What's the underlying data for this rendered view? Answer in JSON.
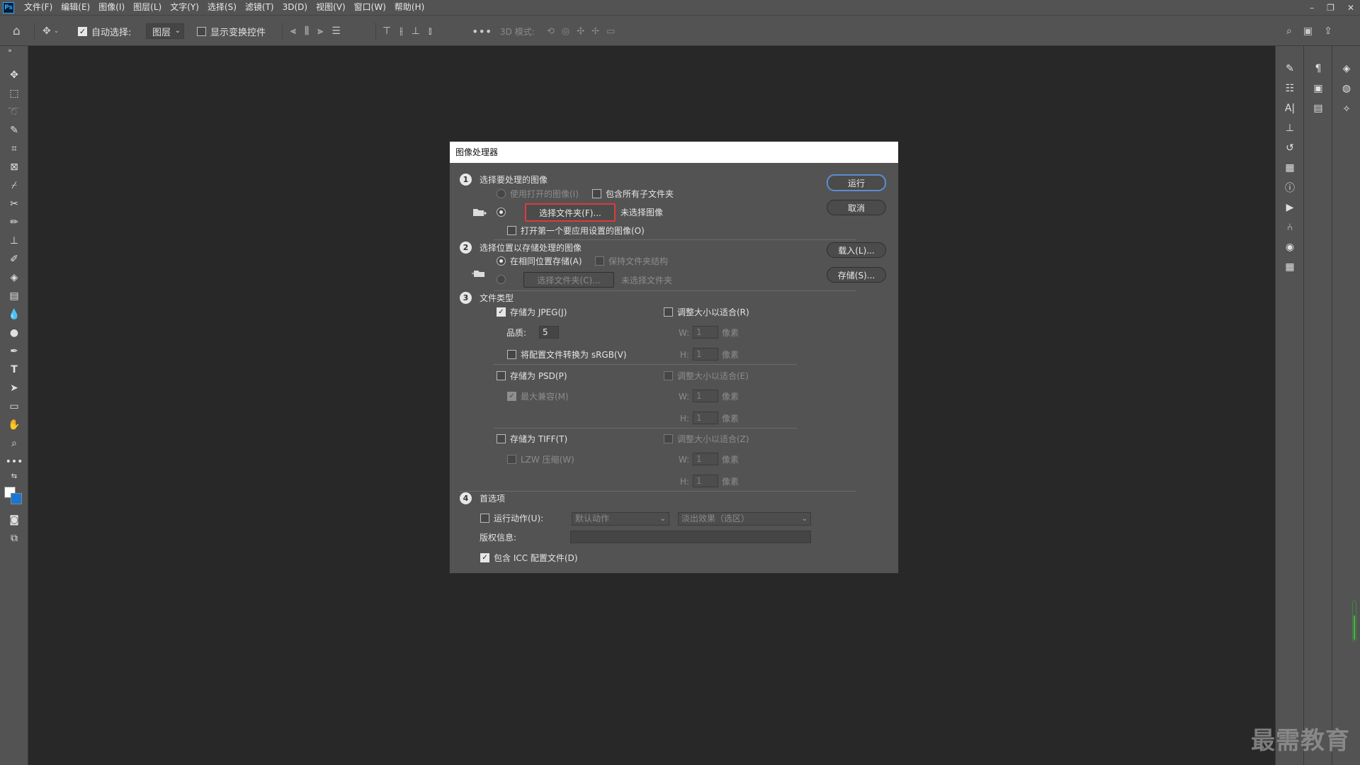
{
  "app": {
    "logo": "Ps"
  },
  "menu": [
    "文件(F)",
    "编辑(E)",
    "图像(I)",
    "图层(L)",
    "文字(Y)",
    "选择(S)",
    "滤镜(T)",
    "3D(D)",
    "视图(V)",
    "窗口(W)",
    "帮助(H)"
  ],
  "window_controls": {
    "minimize": "–",
    "restore": "❐",
    "close": "✕"
  },
  "options": {
    "auto_select_label": "自动选择:",
    "auto_select_checked": true,
    "layer_select_value": "图层",
    "show_transform_label": "显示变换控件",
    "show_transform_checked": false,
    "mode_3d_label": "3D 模式:"
  },
  "dialog": {
    "title": "图像处理器",
    "section1": {
      "num": "1",
      "title": "选择要处理的图像",
      "use_open_label": "使用打开的图像(I)",
      "include_subfolders_label": "包含所有子文件夹",
      "select_folder_button": "选择文件夹(F)...",
      "no_image_selected": "未选择图像",
      "open_first_label": "打开第一个要应用设置的图像(O)"
    },
    "section2": {
      "num": "2",
      "title": "选择位置以存储处理的图像",
      "same_location_label": "在相同位置存储(A)",
      "keep_structure_label": "保持文件夹结构",
      "select_folder_button": "选择文件夹(C)...",
      "no_folder_selected": "未选择文件夹"
    },
    "section3": {
      "num": "3",
      "title": "文件类型",
      "save_jpeg_label": "存储为 JPEG(J)",
      "resize_r_label": "调整大小以适合(R)",
      "quality_label": "品质:",
      "quality_value": "5",
      "w_label": "W:",
      "h_label": "H:",
      "size_value": "1",
      "pixel_unit": "像素",
      "convert_srgb_label": "将配置文件转换为 sRGB(V)",
      "save_psd_label": "存储为 PSD(P)",
      "resize_e_label": "调整大小以适合(E)",
      "max_compat_label": "最大兼容(M)",
      "save_tiff_label": "存储为 TIFF(T)",
      "resize_z_label": "调整大小以适合(Z)",
      "lzw_label": "LZW 压缩(W)"
    },
    "section4": {
      "num": "4",
      "title": "首选项",
      "run_action_label": "运行动作(U):",
      "action_set_value": "默认动作",
      "action_value": "淡出效果（选区）",
      "copyright_label": "版权信息:",
      "copyright_value": "",
      "include_icc_label": "包含 ICC 配置文件(D)"
    },
    "buttons": {
      "run": "运行",
      "cancel": "取消",
      "load": "载入(L)...",
      "save": "存储(S)..."
    }
  },
  "watermark": "最需教育"
}
